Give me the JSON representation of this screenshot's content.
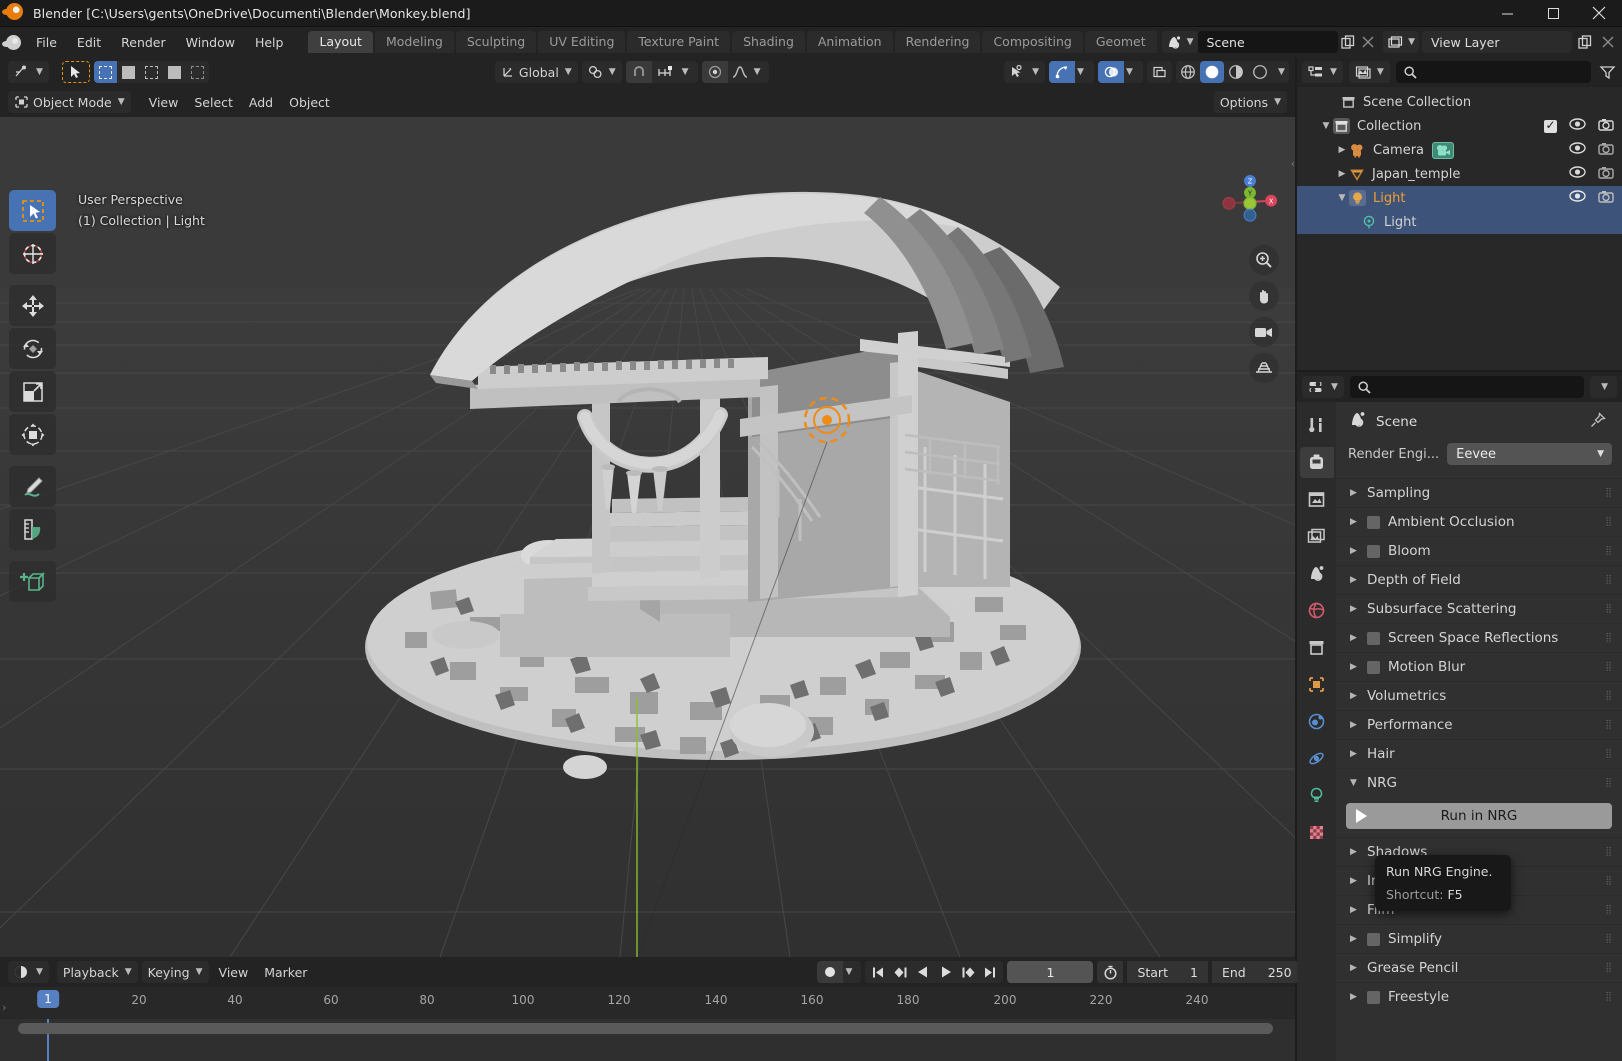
{
  "window": {
    "title": "Blender [C:\\Users\\gents\\OneDrive\\Documenti\\Blender\\Monkey.blend]",
    "minimize": "–",
    "maximize": "□",
    "close": "✕"
  },
  "menu": {
    "items": [
      "File",
      "Edit",
      "Render",
      "Window",
      "Help"
    ]
  },
  "workspace_tabs": {
    "items": [
      "Layout",
      "Modeling",
      "Sculpting",
      "UV Editing",
      "Texture Paint",
      "Shading",
      "Animation",
      "Rendering",
      "Compositing",
      "Geomet"
    ],
    "active": "Layout"
  },
  "scene_selector": {
    "label": "Scene",
    "icon": "scene-icon",
    "new_icon": "copy-icon",
    "unlink_icon": "x-icon"
  },
  "view_layer_selector": {
    "label": "View Layer",
    "icon": "viewlayer-icon",
    "new_icon": "copy-icon",
    "unlink_icon": "x-icon"
  },
  "viewport": {
    "mode": "Object Mode",
    "menus": [
      "View",
      "Select",
      "Add",
      "Object"
    ],
    "transform_orientation": "Global",
    "options_label": "Options",
    "overlay_text_line1": "User Perspective",
    "overlay_text_line2": "(1) Collection | Light",
    "gizmo_axes": {
      "z": "Z",
      "y": "Y",
      "x": "X"
    },
    "tools": [
      "tweak-select-box-tool",
      "cursor-tool",
      "move-tool",
      "rotate-tool",
      "scale-tool",
      "transform-tool",
      "annotate-tool",
      "measure-tool",
      "add-cube-tool"
    ],
    "active_tool": "tweak-select-box-tool",
    "shading_modes": [
      "wireframe",
      "solid",
      "material-preview",
      "rendered"
    ],
    "active_shading": "solid"
  },
  "timeline": {
    "editor_type_icon": "timeline-icon",
    "menus": [
      "Playback",
      "Keying",
      "View",
      "Marker"
    ],
    "current_frame": "1",
    "start_label": "Start",
    "start_value": "1",
    "end_label": "End",
    "end_value": "250",
    "ruler_ticks": [
      "20",
      "40",
      "60",
      "80",
      "100",
      "120",
      "140",
      "160",
      "180",
      "200",
      "220",
      "240"
    ],
    "playhead_label": "1"
  },
  "outliner": {
    "display_mode_icon": "outliner-icon",
    "filter_icon": "filter-icon",
    "search_placeholder": "",
    "rows": [
      {
        "label": "Scene Collection",
        "icon": "collection-icon",
        "indent": 0,
        "disclosure": "",
        "selected": false,
        "has_toggles": false
      },
      {
        "label": "Collection",
        "icon": "collection-icon",
        "indent": 1,
        "disclosure": "▼",
        "selected": false,
        "has_toggles": true,
        "has_checkbox": true
      },
      {
        "label": "Camera",
        "icon": "camera-icon",
        "indent": 2,
        "disclosure": "▶",
        "selected": false,
        "has_toggles": true,
        "badge": "camera-data-icon"
      },
      {
        "label": "Japan_temple",
        "icon": "mesh-icon",
        "indent": 2,
        "disclosure": "▶",
        "selected": false,
        "has_toggles": true
      },
      {
        "label": "Light",
        "icon": "light-object-icon",
        "indent": 2,
        "disclosure": "▼",
        "selected": true,
        "active": true,
        "has_toggles": true
      },
      {
        "label": "Light",
        "icon": "light-data-icon",
        "indent": 3,
        "disclosure": "",
        "selected": true,
        "has_toggles": false
      }
    ]
  },
  "properties": {
    "editor_icon": "properties-icon",
    "search_placeholder": "",
    "breadcrumb": "Scene",
    "breadcrumb_icon": "scene-icon",
    "pin_icon": "pin-icon",
    "render_engine_label": "Render Engi...",
    "render_engine_value": "Eevee",
    "tabs": [
      "tool-tab",
      "render-tab",
      "output-tab",
      "view-layer-tab",
      "scene-tab",
      "world-tab",
      "collection-tab",
      "object-tab",
      "modifiers-tab",
      "physics-tab",
      "data-tab",
      "material-tab"
    ],
    "active_tab": "render-tab",
    "panels": [
      {
        "label": "Sampling",
        "checkbox": false,
        "open": false
      },
      {
        "label": "Ambient Occlusion",
        "checkbox": true,
        "open": false
      },
      {
        "label": "Bloom",
        "checkbox": true,
        "open": false
      },
      {
        "label": "Depth of Field",
        "checkbox": false,
        "open": false
      },
      {
        "label": "Subsurface Scattering",
        "checkbox": false,
        "open": false
      },
      {
        "label": "Screen Space Reflections",
        "checkbox": true,
        "open": false
      },
      {
        "label": "Motion Blur",
        "checkbox": true,
        "open": false
      },
      {
        "label": "Volumetrics",
        "checkbox": false,
        "open": false
      },
      {
        "label": "Performance",
        "checkbox": false,
        "open": false
      },
      {
        "label": "Hair",
        "checkbox": false,
        "open": false
      },
      {
        "label": "NRG",
        "checkbox": false,
        "open": true
      }
    ],
    "run_button_label": "Run in NRG",
    "panels_after": [
      {
        "label": "Shadows",
        "checkbox": false
      },
      {
        "label": "Indirect Lighting",
        "checkbox": false
      },
      {
        "label": "Film",
        "checkbox": false
      },
      {
        "label": "Simplify",
        "checkbox": true
      },
      {
        "label": "Grease Pencil",
        "checkbox": false
      },
      {
        "label": "Freestyle",
        "checkbox": true
      }
    ]
  },
  "tooltip": {
    "title": "Run NRG Engine.",
    "shortcut_label": "Shortcut: ",
    "shortcut_key": "F5"
  },
  "colors": {
    "accent_blue": "#4772b3",
    "blender_orange": "#e87d0d",
    "select_orange": "#f0a030",
    "viewport_bg": "#373737",
    "panel_bg": "#303030",
    "header_bg": "#232323"
  }
}
